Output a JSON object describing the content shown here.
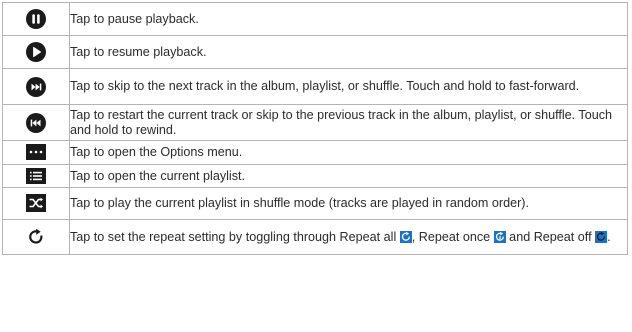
{
  "rows": [
    {
      "icon": "pause-icon",
      "text": "Tap to pause playback."
    },
    {
      "icon": "play-icon",
      "text": "Tap to resume playback."
    },
    {
      "icon": "next-track-icon",
      "text": "Tap to skip to the next track in the album, playlist, or shuffle. Touch and hold to fast-forward."
    },
    {
      "icon": "previous-track-icon",
      "text": "Tap to restart the current track or skip to the previous track in the album, playlist, or shuffle. Touch and hold to rewind."
    },
    {
      "icon": "options-menu-icon",
      "text": "Tap to open the Options menu."
    },
    {
      "icon": "playlist-icon",
      "text": "Tap to open the current playlist."
    },
    {
      "icon": "shuffle-icon",
      "text": "Tap to play the current playlist in shuffle mode (tracks are played in random order)."
    },
    {
      "icon": "repeat-icon",
      "text_a": "Tap to set the repeat setting by toggling through Repeat all ",
      "text_b": ", Repeat once ",
      "text_c": " and Repeat off ",
      "text_d": "."
    }
  ],
  "colors": {
    "icon_fill": "#1a1a1a",
    "repeat_active": "#1a73c6",
    "border": "#b4b4b4",
    "text": "#2b2b2b"
  }
}
